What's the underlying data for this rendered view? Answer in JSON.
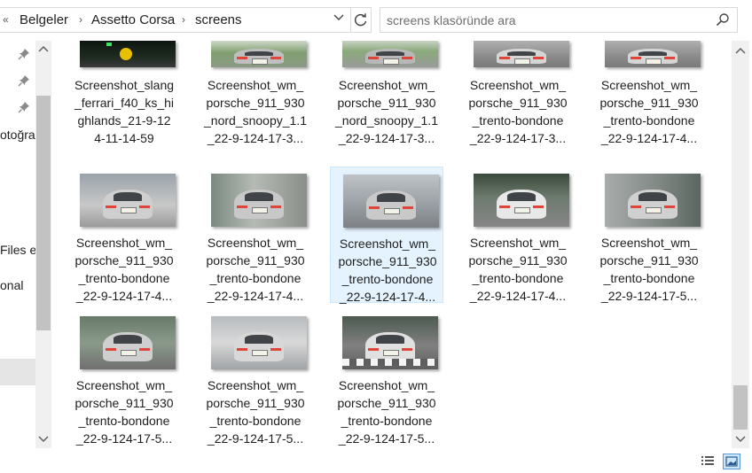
{
  "address": {
    "crumbs": [
      "Belgeler",
      "Assetto Corsa",
      "screens"
    ],
    "back_chevron": "«",
    "separator": "›"
  },
  "search": {
    "placeholder": "screens klasöründe ara"
  },
  "nav": {
    "items": [
      "otoğra",
      "Files  e",
      "onal"
    ]
  },
  "icons": {
    "pin": "pin-icon",
    "search": "search-icon",
    "refresh": "refresh-icon",
    "dropdown": "chevron-down-icon"
  },
  "colors": {
    "selection_bg": "#e5f3ff",
    "selection_border": "#cce8ff",
    "accent": "#5a9ad6"
  },
  "files": [
    {
      "lines": [
        "Screenshot_slang",
        "_ferrari_f40_ks_hi",
        "ghlands_21-9-12",
        "4-11-14-59"
      ],
      "scene": "dash"
    },
    {
      "lines": [
        "Screenshot_wm_",
        "porsche_911_930",
        "_nord_snoopy_1.1",
        "_22-9-124-17-3..."
      ],
      "scene": "rear-green"
    },
    {
      "lines": [
        "Screenshot_wm_",
        "porsche_911_930",
        "_nord_snoopy_1.1",
        "_22-9-124-17-3..."
      ],
      "scene": "rear-green2"
    },
    {
      "lines": [
        "Screenshot_wm_",
        "porsche_911_930",
        "_trento-bondone",
        "_22-9-124-17-3..."
      ],
      "scene": "rear-road"
    },
    {
      "lines": [
        "Screenshot_wm_",
        "porsche_911_930",
        "_trento-bondone",
        "_22-9-124-17-4..."
      ],
      "scene": "rear-road"
    },
    {
      "lines": [
        "Screenshot_wm_",
        "porsche_911_930",
        "_trento-bondone",
        "_22-9-124-17-4..."
      ],
      "scene": "smoke-close"
    },
    {
      "lines": [
        "Screenshot_wm_",
        "porsche_911_930",
        "_trento-bondone",
        "_22-9-124-17-4..."
      ],
      "scene": "rear-wall"
    },
    {
      "lines": [
        "Screenshot_wm_",
        "porsche_911_930",
        "_trento-bondone",
        "_22-9-124-17-4..."
      ],
      "scene": "rear-smoke",
      "selected": true
    },
    {
      "lines": [
        "Screenshot_wm_",
        "porsche_911_930",
        "_trento-bondone",
        "_22-9-124-17-4..."
      ],
      "scene": "side-white"
    },
    {
      "lines": [
        "Screenshot_wm_",
        "porsche_911_930",
        "_trento-bondone",
        "_22-9-124-17-5..."
      ],
      "scene": "side-wall"
    },
    {
      "lines": [
        "Screenshot_wm_",
        "porsche_911_930",
        "_trento-bondone",
        "_22-9-124-17-5..."
      ],
      "scene": "front-hill"
    },
    {
      "lines": [
        "Screenshot_wm_",
        "porsche_911_930",
        "_trento-bondone",
        "_22-9-124-17-5..."
      ],
      "scene": "smoke-fog"
    },
    {
      "lines": [
        "Screenshot_wm_",
        "porsche_911_930",
        "_trento-bondone",
        "_22-9-124-17-5..."
      ],
      "scene": "crosswalk"
    }
  ]
}
